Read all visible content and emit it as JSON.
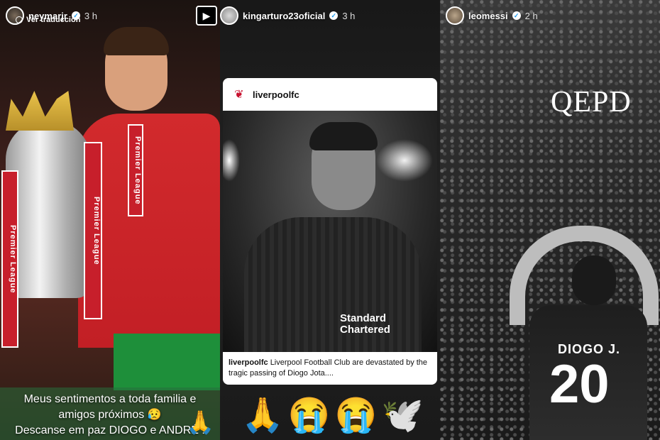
{
  "stories": [
    {
      "username": "neymarjr",
      "time": "3 h",
      "subline": "Ver traducción",
      "ribbon_text": "Premier League",
      "caption_lines": [
        "Meus sentimentos a toda familia e",
        "amigos próximos 😥",
        "Descanse em paz DIOGO e ANDRÉ !"
      ],
      "emoji": "🙏"
    },
    {
      "username": "kingarturo23oficial",
      "time": "3 h",
      "play_icon": "play-icon",
      "post": {
        "username": "liverpoolfc",
        "caption_user": "liverpoolfc",
        "caption_text": "Liverpool Football Club are devastated by the tragic passing of Diogo Jota....",
        "sponsor_line1": "Standard",
        "sponsor_line2": "Chartered"
      },
      "emojis": [
        "🙏",
        "😭",
        "😭",
        "🕊️"
      ]
    },
    {
      "username": "leomessi",
      "time": "2 h",
      "overlay_text": "QEPD",
      "jersey_name": "DIOGO J.",
      "jersey_number": "20"
    }
  ],
  "colors": {
    "lfc_red": "#c8102e",
    "verified_blue": "#1d9bf0"
  }
}
